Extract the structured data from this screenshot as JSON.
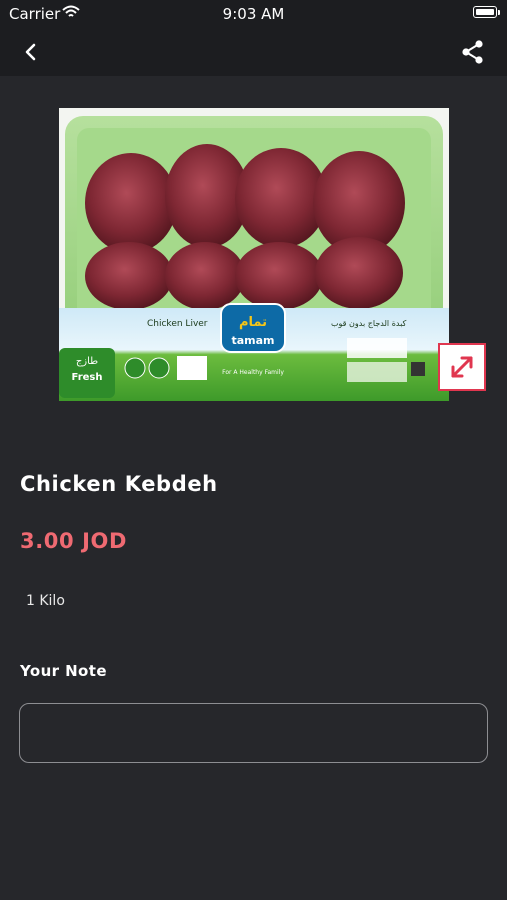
{
  "status_bar": {
    "carrier": "Carrier",
    "time": "9:03 AM"
  },
  "nav": {
    "back_icon": "chevron-left-icon",
    "share_icon": "share-icon"
  },
  "product": {
    "image_label_en": "Chicken Liver",
    "image_label_ar": "كبدة الدجاج بدون قوب",
    "image_brand": "tamam",
    "image_brand_ar": "تمام",
    "image_badge_ar": "طازج",
    "image_badge_en": "Fresh",
    "image_tagline": "For A Healthy Family",
    "title": "Chicken Kebdeh",
    "price": "3.00 JOD",
    "unit": "1 Kilo"
  },
  "note": {
    "label": "Your Note",
    "placeholder": ""
  },
  "colors": {
    "background": "#26272b",
    "bar": "#1c1d20",
    "price": "#ef6a72",
    "accent": "#e0364f"
  }
}
